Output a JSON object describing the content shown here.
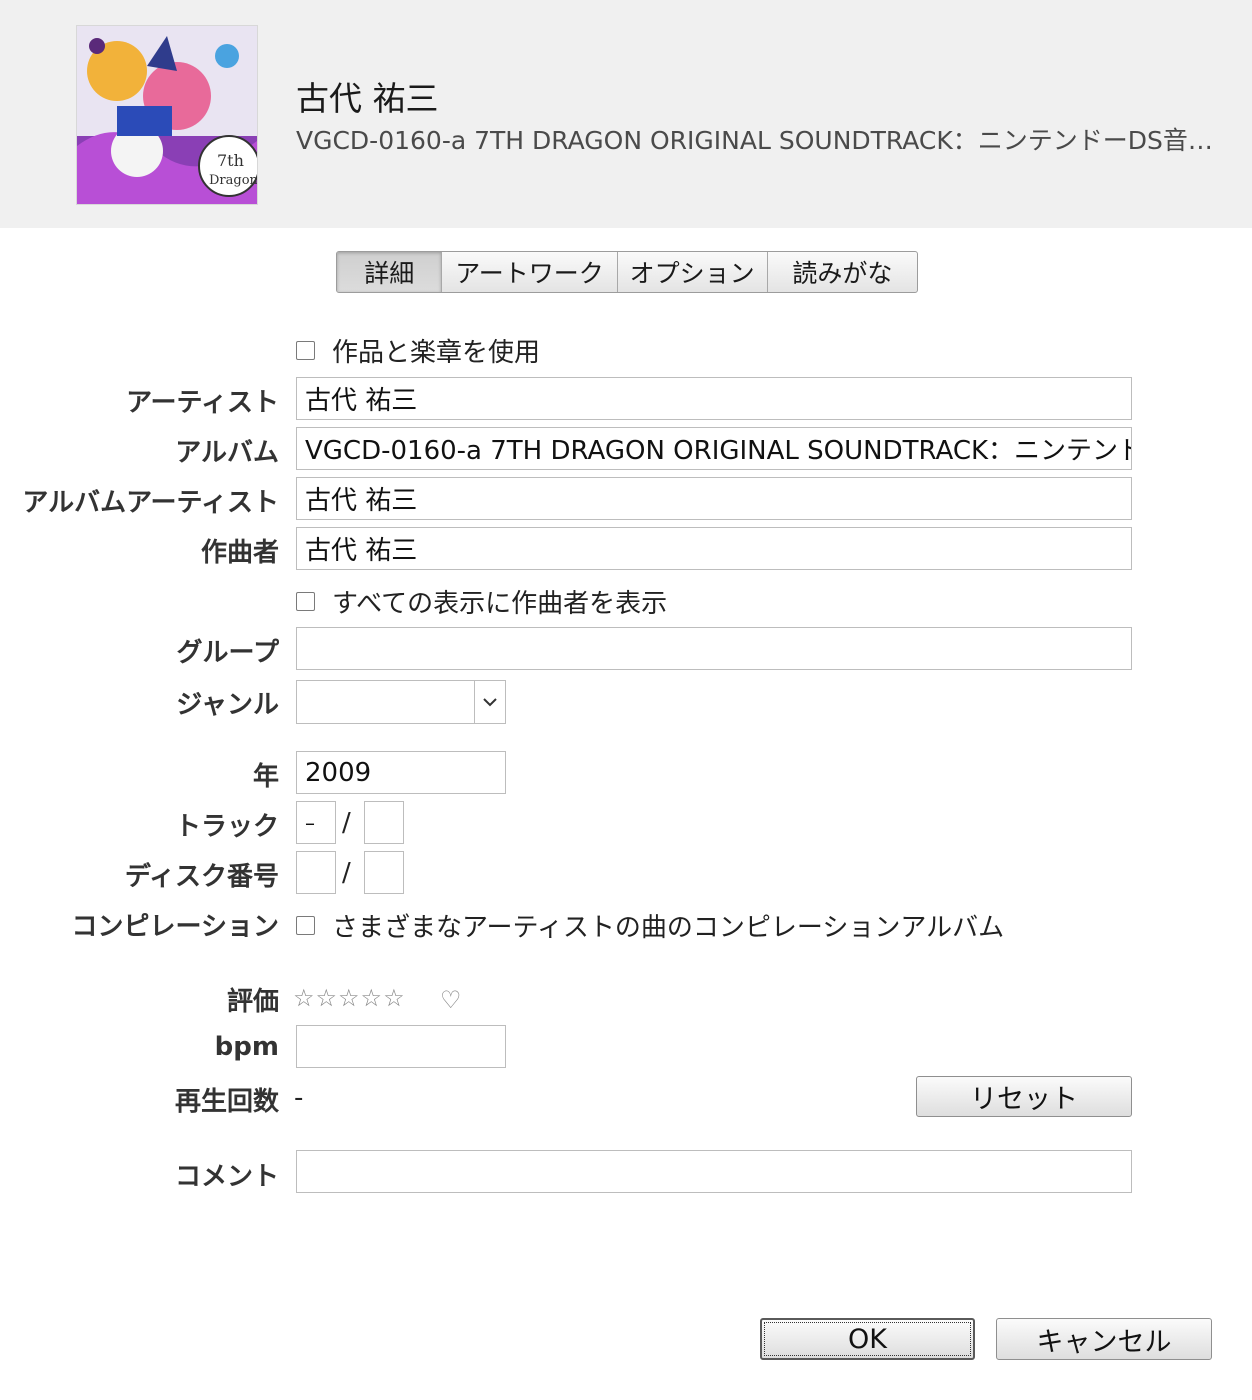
{
  "header": {
    "title": "古代 祐三",
    "subtitle": "VGCD-0160-a 7TH DRAGON ORIGINAL SOUNDTRACK：ニンテンドーDS音源v..."
  },
  "tabs": [
    "詳細",
    "アートワーク",
    "オプション",
    "読みがな"
  ],
  "form": {
    "use_work_movement_label": "作品と楽章を使用",
    "artist_label": "アーティスト",
    "artist_value": "古代 祐三",
    "album_label": "アルバム",
    "album_value": "VGCD-0160-a 7TH DRAGON ORIGINAL SOUNDTRACK：ニンテンドーD",
    "album_artist_label": "アルバムアーティスト",
    "album_artist_value": "古代 祐三",
    "composer_label": "作曲者",
    "composer_value": "古代 祐三",
    "show_composer_label": "すべての表示に作曲者を表示",
    "grouping_label": "グループ",
    "grouping_value": "",
    "genre_label": "ジャンル",
    "genre_value": "",
    "year_label": "年",
    "year_value": "2009",
    "track_label": "トラック",
    "track_number": "–",
    "track_total": "",
    "disc_label": "ディスク番号",
    "disc_number": "",
    "disc_total": "",
    "slash": "/",
    "compilation_label": "コンピレーション",
    "compilation_checkbox_label": "さまざまなアーティストの曲のコンピレーションアルバム",
    "rating_label": "評価",
    "rating_stars": "☆☆☆☆☆",
    "rating_value": 0,
    "heart": "♡",
    "bpm_label": "bpm",
    "bpm_value": "",
    "play_count_label": "再生回数",
    "play_count_value": "-",
    "reset_label": "リセット",
    "comment_label": "コメント",
    "comment_value": ""
  },
  "buttons": {
    "ok": "OK",
    "cancel": "キャンセル"
  },
  "icons": {
    "genre_dropdown": "chevron-down-icon",
    "album_art": "album-artwork"
  },
  "colors": {
    "header_bg": "#f0f0f0",
    "field_border": "#bdbdbd",
    "label_text": "#333333"
  }
}
